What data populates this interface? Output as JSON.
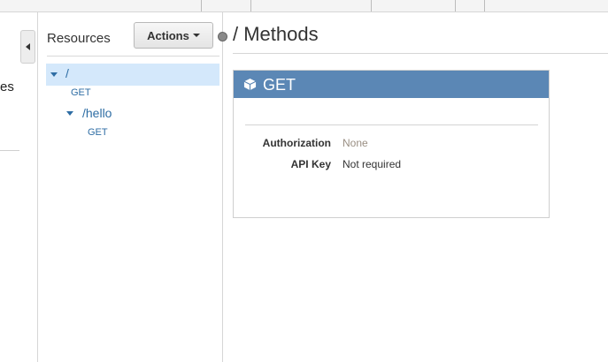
{
  "left_nav": {
    "label": "es"
  },
  "resources_panel": {
    "title": "Resources",
    "actions_label": "Actions",
    "tree": {
      "root": {
        "path": "/",
        "method": "GET"
      },
      "child": {
        "path": "/hello",
        "method": "GET"
      }
    }
  },
  "main": {
    "title": "/ Methods",
    "method_panel": {
      "method": "GET",
      "fields": [
        {
          "label": "Authorization",
          "value": "None",
          "value_color": "#9a8f83"
        },
        {
          "label": "API Key",
          "value": "Not required",
          "value_color": "#333333"
        }
      ]
    }
  },
  "icons": {
    "toggle": "collapse-left-icon",
    "tree_expand": "chevron-down-icon",
    "method": "cube-icon",
    "actions_caret": "caret-down-icon"
  },
  "colors": {
    "method_header": "#5b87b5",
    "tree_selected": "#d4e8fb",
    "link": "#2e6da4"
  }
}
